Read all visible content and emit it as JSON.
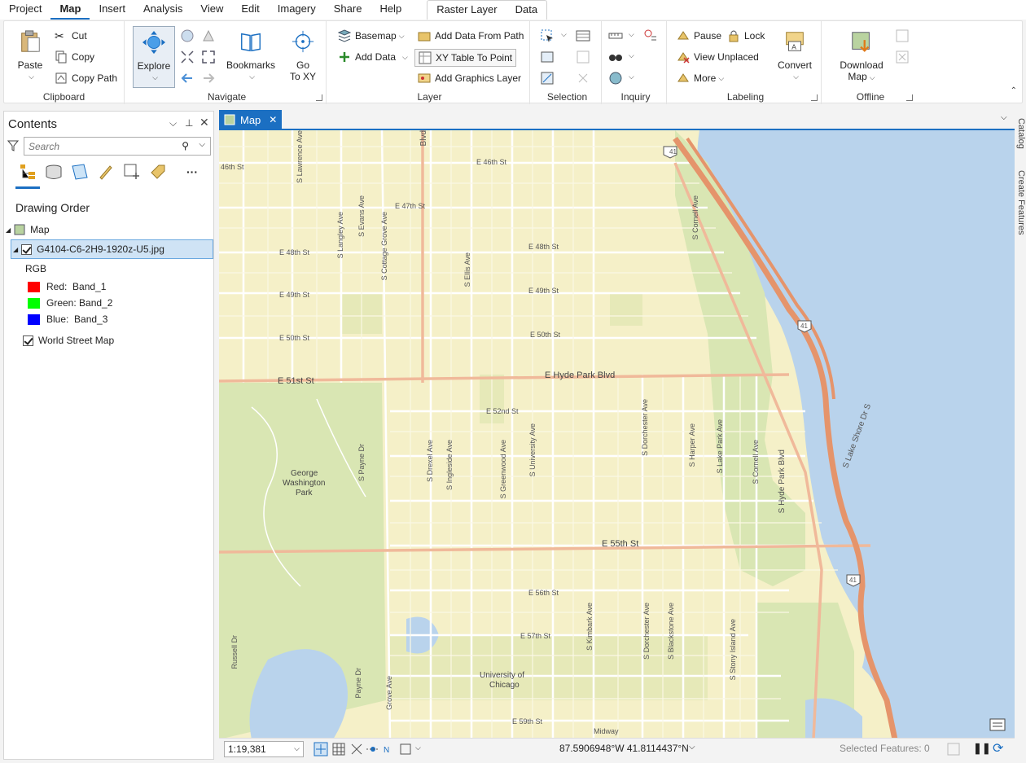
{
  "menu": {
    "items": [
      "Project",
      "Map",
      "Insert",
      "Analysis",
      "View",
      "Edit",
      "Imagery",
      "Share",
      "Help"
    ],
    "contextual": [
      "Raster Layer",
      "Data"
    ]
  },
  "ribbon": {
    "clipboard": {
      "paste": "Paste",
      "cut": "Cut",
      "copy": "Copy",
      "copy_path": "Copy Path",
      "title": "Clipboard"
    },
    "navigate": {
      "explore": "Explore",
      "bookmarks": "Bookmarks",
      "goto_line1": "Go",
      "goto_line2": "To XY",
      "title": "Navigate"
    },
    "layer": {
      "basemap": "Basemap",
      "add_data": "Add Data",
      "add_from_path": "Add Data From Path",
      "xy_table": "XY Table To Point",
      "add_graphics": "Add Graphics Layer",
      "title": "Layer"
    },
    "selection": {
      "title": "Selection"
    },
    "inquiry": {
      "title": "Inquiry"
    },
    "labeling": {
      "pause": "Pause",
      "lock": "Lock",
      "view_unplaced": "View Unplaced",
      "more": "More",
      "convert": "Convert",
      "title": "Labeling"
    },
    "offline": {
      "download_line1": "Download",
      "download_line2": "Map",
      "title": "Offline"
    }
  },
  "contents": {
    "title": "Contents",
    "search_placeholder": "Search",
    "drawing_order": "Drawing Order",
    "map_label": "Map",
    "layer_name": "G4104-C6-2H9-1920z-U5.jpg",
    "rgb": "RGB",
    "bands": [
      {
        "label": "Red:",
        "band": "Band_1",
        "color": "#ff0000"
      },
      {
        "label": "Green:",
        "band": "Band_2",
        "color": "#00ff00"
      },
      {
        "label": "Blue:",
        "band": "Band_3",
        "color": "#0000ff"
      }
    ],
    "basemap_layer": "World Street Map"
  },
  "map_tab": {
    "label": "Map"
  },
  "map_labels": {
    "e46": "E 46th St",
    "e46b": "46th St",
    "e47": "E 47th St",
    "e48": "E 48th St",
    "e48b": "E 48th St",
    "e49": "E 49th St",
    "e49b": "E 49th St",
    "e50": "E 50th St",
    "e50b": "E 50th St",
    "e51": "E 51st St",
    "hyde": "E Hyde Park Blvd",
    "e52": "E 52nd St",
    "e55": "E 55th St",
    "e56": "E 56th St",
    "e57": "E 57th St",
    "e59": "E 59th St",
    "park1": "George",
    "park2": "Washington",
    "park3": "Park",
    "uc1": "University of",
    "uc2": "Chicago",
    "lsd": "S Lake Shore Dr S",
    "shyde": "S Hyde Park Blvd",
    "cornell": "S Cornell Ave",
    "cornell2": "S Cornell Ave",
    "evans": "S Evans Ave",
    "cottage": "S Cottage Grove Ave",
    "langley": "S Langley Ave",
    "ellis": "S Ellis Ave",
    "lawrence": "S Lawrence Ave",
    "drexel": "S Drexel Ave",
    "ingleside": "S Ingleside Ave",
    "greenwood": "S Greenwood Ave",
    "university": "S University Ave",
    "dorchester": "S Dorchester Ave",
    "dorchester2": "S Dorchester Ave",
    "harper": "S Harper Ave",
    "lakepark": "S Lake Park Ave",
    "kimbark": "S Kimbark Ave",
    "blackstone": "S Blackstone Ave",
    "stony": "S Stony Island Ave",
    "payne": "S Payne Dr",
    "payne2": "Payne Dr",
    "russell": "Russell Dr",
    "grove": "Grove Ave",
    "blvd": "Blvd",
    "midway": "Midway",
    "r41a": "41",
    "r41b": "41",
    "r41c": "41"
  },
  "status": {
    "scale": "1:19,381",
    "coords": "87.5906948°W 41.8114437°N",
    "selected": "Selected Features: 0"
  },
  "right_sidebar": {
    "catalog": "Catalog",
    "create_features": "Create Features"
  },
  "colors": {
    "accent": "#1b6fc2",
    "land": "#f5f0c8",
    "water": "#b9d3ec",
    "park": "#d9e6b3",
    "highway": "#e5946b",
    "arterial": "#f0b99a"
  }
}
